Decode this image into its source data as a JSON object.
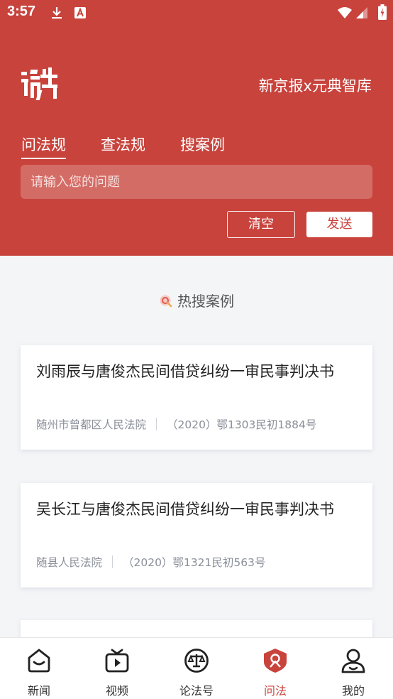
{
  "status": {
    "time": "3:57"
  },
  "header": {
    "brand": "新京报x元典智库",
    "tabs": [
      {
        "label": "问法规",
        "active": true
      },
      {
        "label": "查法规",
        "active": false
      },
      {
        "label": "搜案例",
        "active": false
      }
    ],
    "search_placeholder": "请输入您的问题",
    "clear_label": "清空",
    "send_label": "发送"
  },
  "section": {
    "title": "热搜案例"
  },
  "cases": [
    {
      "title": "刘雨辰与唐俊杰民间借贷纠纷一审民事判决书",
      "court": "随州市曾都区人民法院",
      "case_no": "（2020）鄂1303民初1884号"
    },
    {
      "title": "吴长江与唐俊杰民间借贷纠纷一审民事判决书",
      "court": "随县人民法院",
      "case_no": "（2020）鄂1321民初563号"
    }
  ],
  "nav": [
    {
      "label": "新闻",
      "icon": "news-icon",
      "active": false
    },
    {
      "label": "视频",
      "icon": "video-icon",
      "active": false
    },
    {
      "label": "论法号",
      "icon": "law-scale-icon",
      "active": false
    },
    {
      "label": "问法",
      "icon": "ask-law-icon",
      "active": true
    },
    {
      "label": "我的",
      "icon": "profile-icon",
      "active": false
    }
  ],
  "colors": {
    "brand": "#c8433c",
    "background": "#f4f5f7"
  }
}
